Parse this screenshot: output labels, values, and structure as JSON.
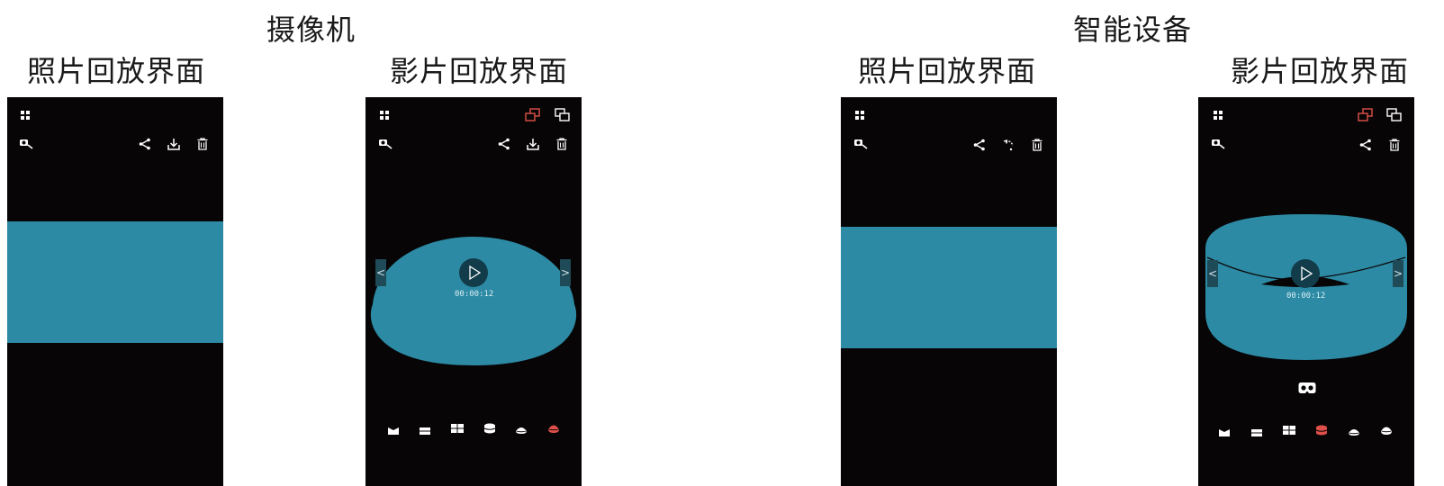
{
  "groups": {
    "camera": "摄像机",
    "smart_device": "智能设备"
  },
  "screens": [
    {
      "caption": "照片回放界面"
    },
    {
      "caption": "影片回放界面",
      "timecode": "00:00:12"
    },
    {
      "caption": "照片回放界面"
    },
    {
      "caption": "影片回放界面",
      "timecode": "00:00:12"
    }
  ],
  "colors": {
    "screen_bg": "#070505",
    "media": "#2d8aa4",
    "accent": "#e0504a",
    "icon": "#ffffff"
  },
  "icons": {
    "grid": "grid-icon",
    "camera_switch": "camera-switch-icon",
    "share": "share-icon",
    "download": "download-icon",
    "delete": "trash-icon",
    "rotate": "rotate-icon",
    "view_mode_a": "view-mode-icon",
    "view_mode_b": "view-mode-alt-icon",
    "vr": "vr-headset-icon",
    "play": "play-icon"
  },
  "modes": {
    "camera_video": [
      "panorama",
      "split-2",
      "split-4",
      "cylinder",
      "dome",
      "globe"
    ],
    "device_video": [
      "panorama",
      "split-2",
      "split-4",
      "cylinder",
      "dome",
      "globe"
    ],
    "camera_video_selected": 5,
    "device_video_selected": 3
  }
}
